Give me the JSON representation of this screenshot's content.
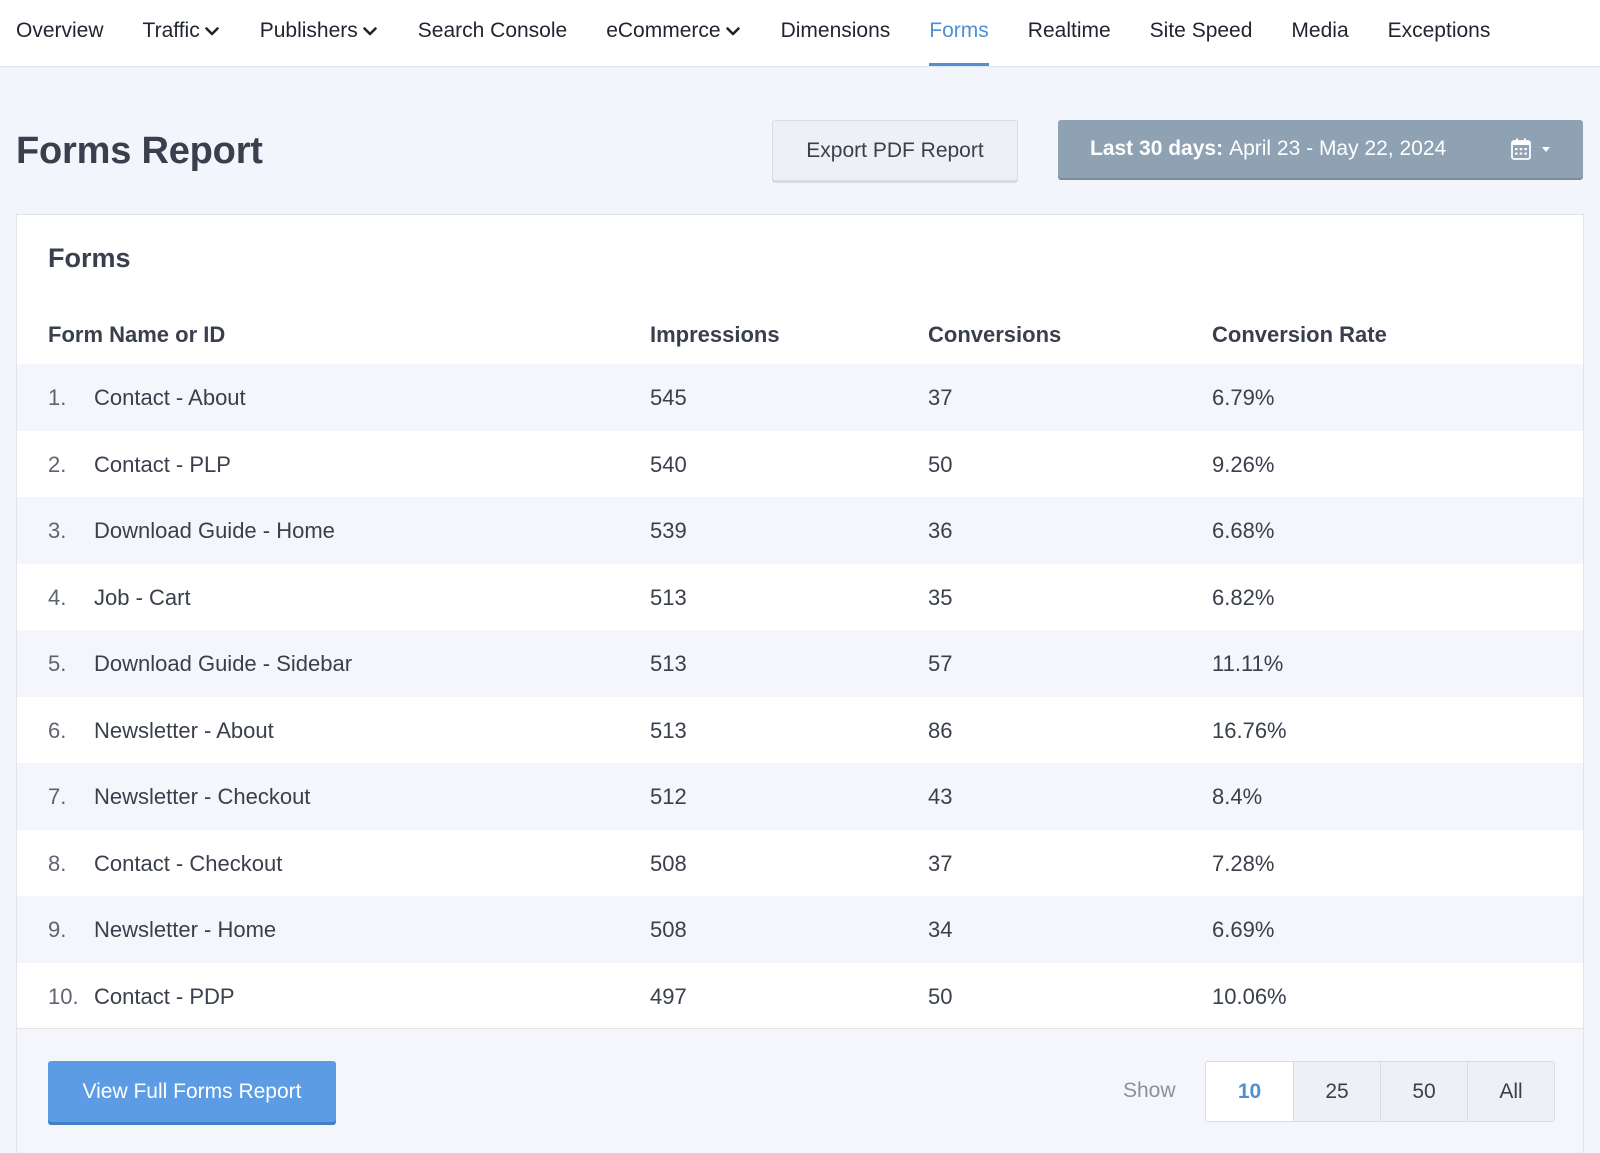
{
  "nav": {
    "items": [
      {
        "label": "Overview",
        "dropdown": false
      },
      {
        "label": "Traffic",
        "dropdown": true
      },
      {
        "label": "Publishers",
        "dropdown": true
      },
      {
        "label": "Search Console",
        "dropdown": false
      },
      {
        "label": "eCommerce",
        "dropdown": true
      },
      {
        "label": "Dimensions",
        "dropdown": false
      },
      {
        "label": "Forms",
        "dropdown": false,
        "active": true
      },
      {
        "label": "Realtime",
        "dropdown": false
      },
      {
        "label": "Site Speed",
        "dropdown": false
      },
      {
        "label": "Media",
        "dropdown": false
      },
      {
        "label": "Exceptions",
        "dropdown": false
      }
    ]
  },
  "header": {
    "title": "Forms Report",
    "export_label": "Export PDF Report",
    "date_prefix": "Last 30 days:",
    "date_range": "April 23 - May 22, 2024",
    "calendar_icon": "calendar-icon"
  },
  "panel": {
    "title": "Forms",
    "columns": {
      "name": "Form Name or ID",
      "impressions": "Impressions",
      "conversions": "Conversions",
      "rate": "Conversion Rate"
    },
    "rows": [
      {
        "num": "1.",
        "name": "Contact - About",
        "impressions": "545",
        "conversions": "37",
        "rate": "6.79%"
      },
      {
        "num": "2.",
        "name": "Contact - PLP",
        "impressions": "540",
        "conversions": "50",
        "rate": "9.26%"
      },
      {
        "num": "3.",
        "name": "Download Guide - Home",
        "impressions": "539",
        "conversions": "36",
        "rate": "6.68%"
      },
      {
        "num": "4.",
        "name": "Job - Cart",
        "impressions": "513",
        "conversions": "35",
        "rate": "6.82%"
      },
      {
        "num": "5.",
        "name": "Download Guide - Sidebar",
        "impressions": "513",
        "conversions": "57",
        "rate": "11.11%"
      },
      {
        "num": "6.",
        "name": "Newsletter - About",
        "impressions": "513",
        "conversions": "86",
        "rate": "16.76%"
      },
      {
        "num": "7.",
        "name": "Newsletter - Checkout",
        "impressions": "512",
        "conversions": "43",
        "rate": "8.4%"
      },
      {
        "num": "8.",
        "name": "Contact - Checkout",
        "impressions": "508",
        "conversions": "37",
        "rate": "7.28%"
      },
      {
        "num": "9.",
        "name": "Newsletter - Home",
        "impressions": "508",
        "conversions": "34",
        "rate": "6.69%"
      },
      {
        "num": "10.",
        "name": "Contact - PDP",
        "impressions": "497",
        "conversions": "50",
        "rate": "10.06%"
      }
    ],
    "footer": {
      "full_report_label": "View Full Forms Report",
      "show_label": "Show",
      "page_sizes": [
        "10",
        "25",
        "50",
        "All"
      ],
      "selected_page_size": "10"
    }
  },
  "colors": {
    "accent": "#4e8fd6",
    "primary_button": "#5b9ce4",
    "date_button": "#8ea2b4",
    "background": "#f2f5fb"
  }
}
